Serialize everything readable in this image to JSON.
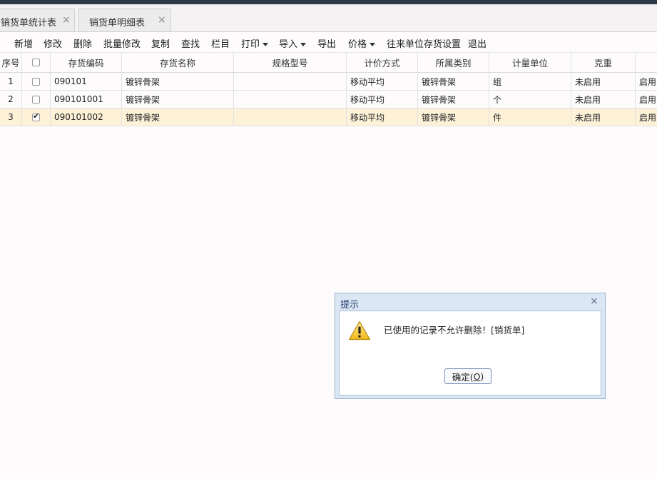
{
  "tabs": [
    {
      "label": "销货单统计表"
    },
    {
      "label": "销货单明细表"
    }
  ],
  "toolbar": {
    "add": "新增",
    "edit": "修改",
    "delete": "删除",
    "batch_edit": "批量修改",
    "copy": "复制",
    "find": "查找",
    "columns": "栏目",
    "print": "打印",
    "import": "导入",
    "export": "导出",
    "price": "价格",
    "partner_settings": "往来单位存货设置",
    "exit": "退出"
  },
  "table": {
    "headers": {
      "seq": "序号",
      "code": "存货编码",
      "name": "存货名称",
      "spec": "规格型号",
      "pricing": "计价方式",
      "category": "所属类别",
      "unit": "计量单位",
      "weight": "克重"
    },
    "rows": [
      {
        "seq": "1",
        "checked": false,
        "code": "090101",
        "name": "镀锌骨架",
        "spec": "",
        "pricing": "移动平均",
        "category": "镀锌骨架",
        "unit": "组",
        "weight": "未启用",
        "more": "启用"
      },
      {
        "seq": "2",
        "checked": false,
        "code": "090101001",
        "name": "镀锌骨架",
        "spec": "",
        "pricing": "移动平均",
        "category": "镀锌骨架",
        "unit": "个",
        "weight": "未启用",
        "more": "启用"
      },
      {
        "seq": "3",
        "checked": true,
        "code": "090101002",
        "name": "镀锌骨架",
        "spec": "",
        "pricing": "移动平均",
        "category": "镀锌骨架",
        "unit": "件",
        "weight": "未启用",
        "more": "启用"
      }
    ]
  },
  "dialog": {
    "title": "提示",
    "message": "已使用的记录不允许删除！[销货单]",
    "ok_label": "确定(O)",
    "ok_prefix": "确定(",
    "ok_hotkey": "O",
    "ok_suffix": ")",
    "icon": "warning-icon"
  },
  "colors": {
    "selected_row": "#fdf1d8",
    "dialog_frame": "#dbe7f4",
    "title_bar": "#2e3a48"
  }
}
